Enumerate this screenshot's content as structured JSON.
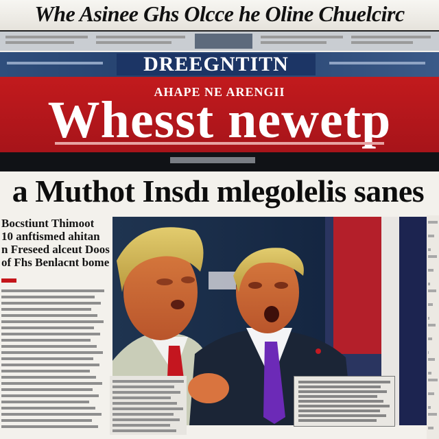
{
  "masthead": {
    "title": "Whe Asinee Ghs Olcce he Oline Chuelcirc"
  },
  "blue_band": {
    "title": "DREEGNTITN"
  },
  "red_banner": {
    "kicker": "AHAPE NE ARENGII",
    "headline": "Whesst newetp"
  },
  "main_headline": "a Muthot Insdı mlegolelis sanes",
  "left_column": {
    "lines": [
      "Bocstiunt Thimoot",
      "10 anftismed ahitan",
      "n Freseed alceut Doos",
      "of Fhs Benlacnt bome"
    ]
  },
  "colors": {
    "banner_red": "#b8171c",
    "band_blue": "#2b4877",
    "black_bar": "#101216",
    "paper": "#f3f1ec"
  }
}
